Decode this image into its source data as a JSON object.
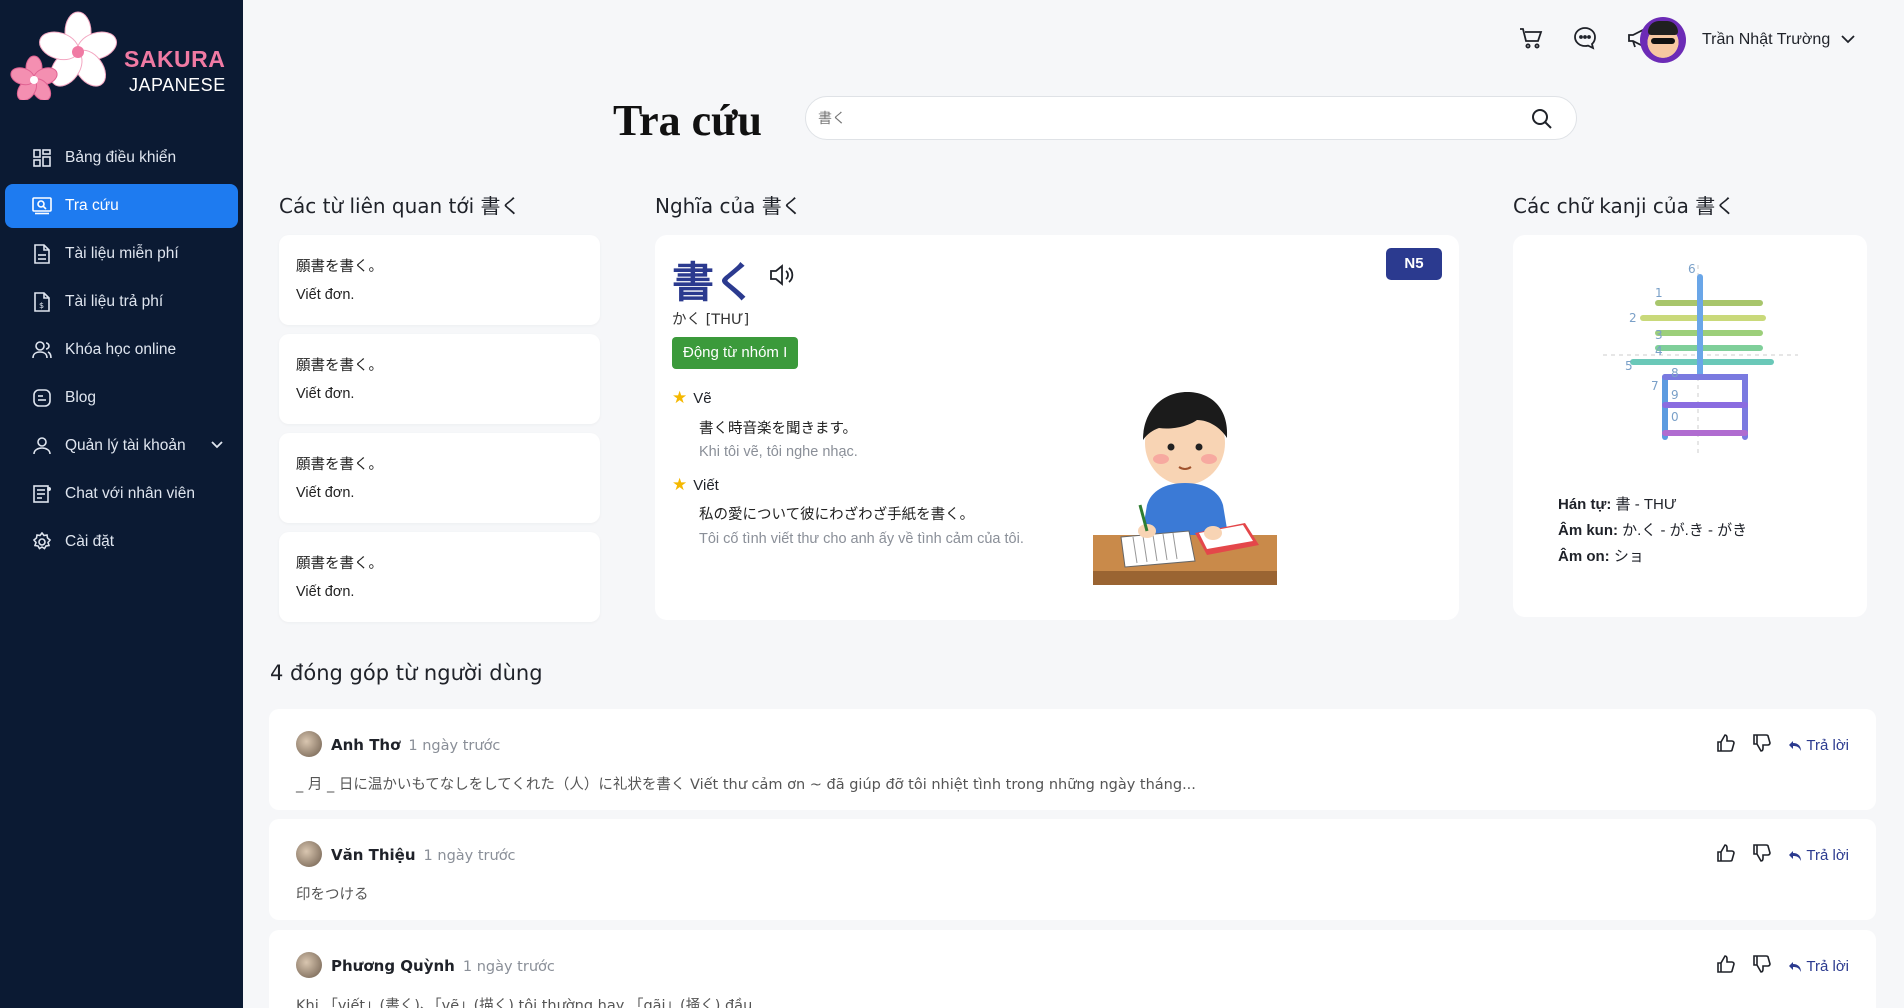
{
  "brand": {
    "line1": "SAKURA",
    "line2": "JAPANESE"
  },
  "sidebar": {
    "items": [
      {
        "label": "Bảng điều khiển",
        "icon": "dashboard-icon"
      },
      {
        "label": "Tra cứu",
        "icon": "search-box-icon",
        "active": true
      },
      {
        "label": "Tài liệu miễn phí",
        "icon": "document-icon"
      },
      {
        "label": "Tài liệu trả phí",
        "icon": "paid-document-icon"
      },
      {
        "label": "Khóa học online",
        "icon": "users-icon"
      },
      {
        "label": "Blog",
        "icon": "blog-icon"
      },
      {
        "label": "Quản lý tài khoản",
        "icon": "user-icon",
        "has_submenu": true
      },
      {
        "label": "Chat với nhân viên",
        "icon": "chat-list-icon"
      },
      {
        "label": "Cài đặt",
        "icon": "gear-icon"
      }
    ]
  },
  "header": {
    "icons": [
      "cart-icon",
      "message-icon",
      "megaphone-icon"
    ],
    "user_name": "Trần Nhật Trường"
  },
  "search": {
    "title": "Tra cứu",
    "value": "",
    "placeholder": "書く"
  },
  "related": {
    "title": "Các từ liên quan tới 書く",
    "items": [
      {
        "jp": "願書を書く。",
        "vi": "Viết đơn."
      },
      {
        "jp": "願書を書く。",
        "vi": "Viết đơn."
      },
      {
        "jp": "願書を書く。",
        "vi": "Viết đơn."
      },
      {
        "jp": "願書を書く。",
        "vi": "Viết đơn."
      }
    ]
  },
  "meaning": {
    "title": "Nghĩa của 書く",
    "word": "書く",
    "reading": "かく [THƯ]",
    "word_type": "Động từ nhóm I",
    "level": "N5",
    "senses": [
      {
        "label": "Vẽ",
        "example": "書く時音楽を聞きます。",
        "translation": "Khi tôi vẽ, tôi nghe nhạc."
      },
      {
        "label": "Viết",
        "example": "私の愛について彼にわざわざ手紙を書く。",
        "translation": "Tôi cố tình viết thư cho anh ấy về tình cảm của tôi."
      }
    ]
  },
  "kanji": {
    "title": "Các chữ kanji của 書く",
    "char": "書",
    "stroke_numbers": [
      "1",
      "2",
      "3",
      "4",
      "5",
      "6",
      "7",
      "8",
      "9",
      "0"
    ],
    "han_tu_label": "Hán tự:",
    "han_tu_value": "書 - THƯ",
    "kun_label": "Âm kun:",
    "kun_value": "か.く - が.き - がき",
    "on_label": "Âm on:",
    "on_value": "ショ"
  },
  "contributions": {
    "title": "4 đóng góp từ người dùng",
    "reply_label": "Trả lời",
    "items": [
      {
        "name": "Anh Thơ",
        "time": "1 ngày trước",
        "text": "_ 月 _ 日に温かいもてなしをしてくれた（人）に礼状を書く Viết thư cảm ơn ~ đã giúp đỡ tôi nhiệt tình trong những ngày tháng..."
      },
      {
        "name": "Văn Thiệu",
        "time": "1 ngày trước",
        "text": "印をつける"
      },
      {
        "name": "Phương Quỳnh",
        "time": "1 ngày trước",
        "text": "Khi 「viết」(書く)、「vẽ」(描く) tôi thường hay 「gãi」(掻く) đầu"
      }
    ]
  },
  "colors": {
    "sidebar_bg": "#0b1a33",
    "active": "#1e7bf0",
    "accent": "#2b3a8f",
    "brand_pink": "#f07aa3",
    "tag_green": "#3b9a3b"
  }
}
